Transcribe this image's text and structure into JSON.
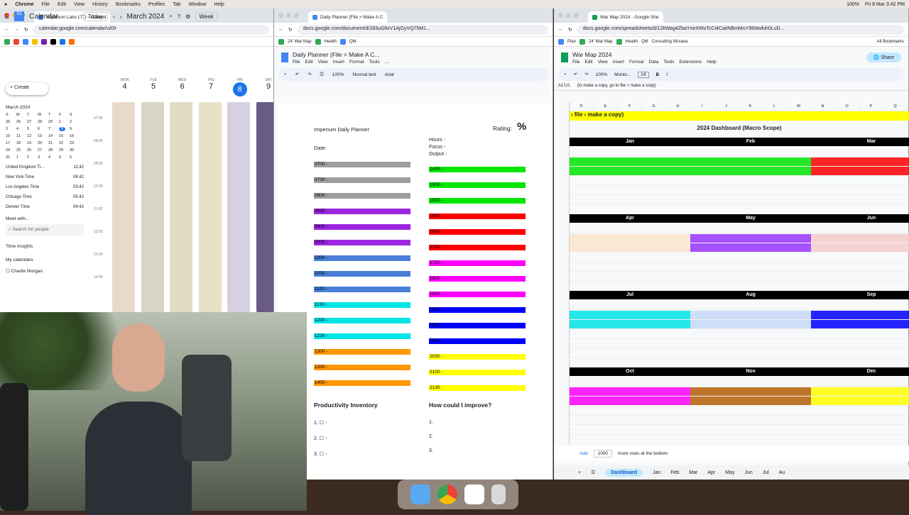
{
  "menubar": {
    "apple": "",
    "app": "Chrome",
    "items": [
      "File",
      "Edit",
      "View",
      "History",
      "Bookmarks",
      "Profiles",
      "Tab",
      "Window",
      "Help"
    ],
    "battery": "100%",
    "datetime": "Fri 8 Mar 3:42 PM"
  },
  "calendar": {
    "tab": "Imperium Labs LTD – Calend",
    "url": "calendar.google.com/calendar/u/0/r",
    "title": "Calendar",
    "today": "Today",
    "month": "March 2024",
    "view": "Week",
    "create": "Create",
    "minical_title": "March 2024",
    "weekdays": [
      "S",
      "M",
      "T",
      "W",
      "T",
      "F",
      "S"
    ],
    "days": [
      [
        "25",
        "26",
        "27",
        "28",
        "29",
        "1",
        "2"
      ],
      [
        "3",
        "4",
        "5",
        "6",
        "7",
        "8",
        "9"
      ],
      [
        "10",
        "11",
        "12",
        "13",
        "14",
        "15",
        "16"
      ],
      [
        "17",
        "18",
        "19",
        "20",
        "21",
        "22",
        "23"
      ],
      [
        "24",
        "25",
        "26",
        "27",
        "28",
        "29",
        "30"
      ],
      [
        "31",
        "1",
        "2",
        "3",
        "4",
        "5",
        "6"
      ]
    ],
    "timezones": [
      {
        "name": "United Kingdom Ti...",
        "time": "11:42"
      },
      {
        "name": "New York Time",
        "time": "06:42"
      },
      {
        "name": "Los Angeles Time",
        "time": "03:42"
      },
      {
        "name": "Chicago Time",
        "time": "05:42"
      },
      {
        "name": "Denver Time",
        "time": "04:42"
      }
    ],
    "meet": "Meet with...",
    "search_people": "Search for people",
    "insights": "Time Insights",
    "my_calendars": "My calendars",
    "cal_person": "Charlie Morgan",
    "week": [
      {
        "dn": "MON",
        "dd": "4"
      },
      {
        "dn": "TUE",
        "dd": "5"
      },
      {
        "dn": "WED",
        "dd": "6"
      },
      {
        "dn": "THU",
        "dd": "7"
      },
      {
        "dn": "FRI",
        "dd": "8"
      },
      {
        "dn": "SAT",
        "dd": "9"
      }
    ],
    "gmt": "GMT+00",
    "hours": [
      "07:00",
      "08:00",
      "09:00",
      "10:00",
      "11:00",
      "12:00",
      "13:00",
      "14:00"
    ]
  },
  "doc": {
    "tab": "Daily Planner (File > Make A C",
    "url": "docs.google.com/document/d/183uG8xV1AjGyVQ75M1...",
    "title": "Daily Planner (File > Make A C...",
    "menu": [
      "File",
      "Edit",
      "View",
      "Insert",
      "Format",
      "Tools",
      "..."
    ],
    "zoom": "100%",
    "style": "Normal text",
    "font": "Arial",
    "heading": "Imperium Daily Planner",
    "rating": "Rating:",
    "pct": "%",
    "date": "Date:",
    "hours": "Hours -",
    "focus": "Focus -",
    "output": "Output -",
    "left_slots": [
      "0700 -",
      "0730 -",
      "0800 -",
      "0830 -",
      "0900 -",
      "0930 -",
      "1000 -",
      "1030 -",
      "1100 -",
      "1130 -",
      "1200 -",
      "1230 -",
      "1300 -",
      "1330 -",
      "1400 -"
    ],
    "right_slots": [
      "1430 -",
      "1500 -",
      "1530 -",
      "1600 -",
      "1630 -",
      "1700 -",
      "1730 -",
      "1800 -",
      "1830 -",
      "1900 -",
      "1930 -",
      "2000 -",
      "2030 -",
      "2100 -",
      "2130 -"
    ],
    "inventory": "Productivity Inventory",
    "improve": "How could I improve?",
    "inv_items": [
      "1.",
      "2.",
      "3."
    ],
    "imp_items": [
      "1.",
      "2.",
      "3."
    ]
  },
  "sheet": {
    "tab": "War Map 2024 - Google She",
    "url": "docs.google.com/spreadsheets/d/12kWag4ZbaYneXWuTcCi4CaiINBmMuY9tNIwfuh0LuD...",
    "title": "War Map 2024",
    "menu": [
      "File",
      "Edit",
      "View",
      "Insert",
      "Format",
      "Data",
      "Tools",
      "Extensions",
      "Help"
    ],
    "share": "Share",
    "cellref": "A1:U1",
    "formula": "(to make a copy, go to file > make a copy)",
    "zoom": "100%",
    "font": "Monts...",
    "fontsize": "14",
    "banner": "› file › make a copy)",
    "dash_title": "2024 Dashboard (Macro Scope)",
    "cols": [
      "D",
      "E",
      "F",
      "G",
      "H",
      "I",
      "J",
      "K",
      "L",
      "M",
      "N",
      "O",
      "P",
      "Q"
    ],
    "months_r1": [
      "Jan",
      "Feb",
      "Mar"
    ],
    "months_r2": [
      "Apr",
      "May",
      "Jun"
    ],
    "months_r3": [
      "Jul",
      "Aug",
      "Sep"
    ],
    "months_r4": [
      "Oct",
      "Nov",
      "Dec"
    ],
    "add": "Add",
    "rows_count": "1000",
    "rows_text": "more rows at the bottom",
    "sheet_tabs": [
      "Dashboard",
      "Jan",
      "Feb",
      "Mar",
      "Apr",
      "May",
      "Jun",
      "Jul",
      "Au"
    ]
  },
  "bookmarks": [
    "Plan",
    "24' War Map",
    "Health",
    "QM",
    "Consulting Nirvana"
  ],
  "all_bookmarks": "All Bookmarks"
}
